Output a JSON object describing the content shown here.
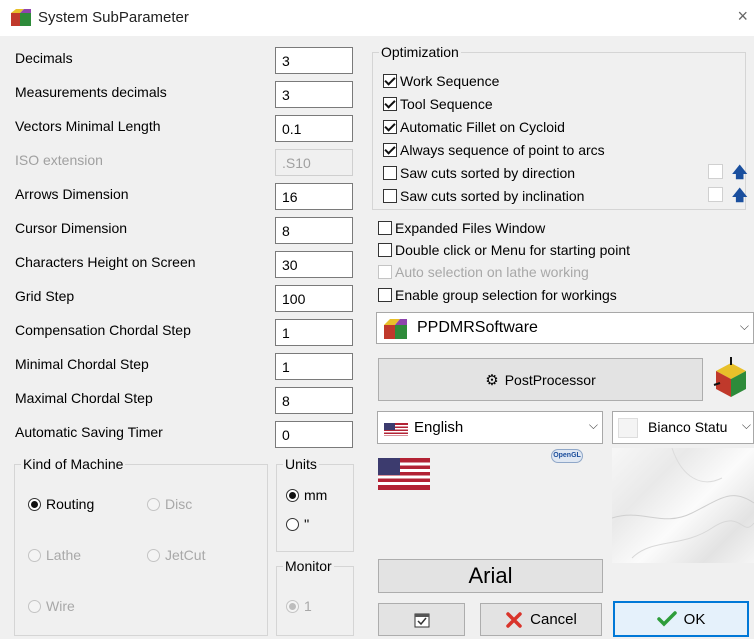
{
  "window": {
    "title": "System SubParameter",
    "close_glyph": "×"
  },
  "fields": [
    {
      "label": "Decimals",
      "value": "3"
    },
    {
      "label": "Measurements decimals",
      "value": "3"
    },
    {
      "label": "Vectors Minimal Length",
      "value": "0.1"
    },
    {
      "label": "ISO extension",
      "value": ".S10",
      "disabled": true
    },
    {
      "label": "Arrows Dimension",
      "value": "16"
    },
    {
      "label": "Cursor Dimension",
      "value": "8"
    },
    {
      "label": "Characters Height on Screen",
      "value": "30"
    },
    {
      "label": "Grid Step",
      "value": "100"
    },
    {
      "label": "Compensation Chordal Step",
      "value": "1"
    },
    {
      "label": "Minimal Chordal Step",
      "value": "1"
    },
    {
      "label": "Maximal Chordal Step",
      "value": "8"
    },
    {
      "label": "Automatic Saving Timer",
      "value": "0"
    }
  ],
  "kind_of_machine": {
    "title": "Kind of Machine",
    "options": [
      {
        "label": "Routing",
        "selected": true
      },
      {
        "label": "Disc"
      },
      {
        "label": "Lathe"
      },
      {
        "label": "JetCut"
      },
      {
        "label": "Wire"
      }
    ]
  },
  "units": {
    "title": "Units",
    "options": [
      {
        "label": "mm",
        "selected": true
      },
      {
        "label": "''"
      }
    ]
  },
  "monitor": {
    "title": "Monitor",
    "value": "1"
  },
  "optimization": {
    "title": "Optimization",
    "items": [
      {
        "label": "Work Sequence",
        "checked": true
      },
      {
        "label": "Tool Sequence",
        "checked": true
      },
      {
        "label": "Automatic Fillet on Cycloid",
        "checked": true
      },
      {
        "label": "Always sequence of point to arcs",
        "checked": true
      },
      {
        "label": "Saw cuts sorted by direction",
        "checked": false
      },
      {
        "label": "Saw cuts sorted by inclination",
        "checked": false
      }
    ]
  },
  "options": [
    {
      "label": "Expanded Files Window",
      "checked": false
    },
    {
      "label": "Double click or Menu for starting point",
      "checked": false
    },
    {
      "label": "Auto selection on lathe working",
      "checked": false,
      "disabled": true
    },
    {
      "label": "Enable group selection for workings",
      "checked": false
    }
  ],
  "software_combo": "PPDMRSoftware",
  "postprocessor_button": "PostProcessor",
  "language_combo": "English",
  "texture_combo": "Bianco Statu",
  "opengl_badge": "OpenGL",
  "font_button": "Arial",
  "cancel_button": "Cancel",
  "ok_button": "OK",
  "chevron": "⌵",
  "arrow_up": "🡅",
  "colors": {
    "accent": "#0078d7",
    "window_bg": "#f0f0f0",
    "arrow": "#1a4f9e"
  }
}
